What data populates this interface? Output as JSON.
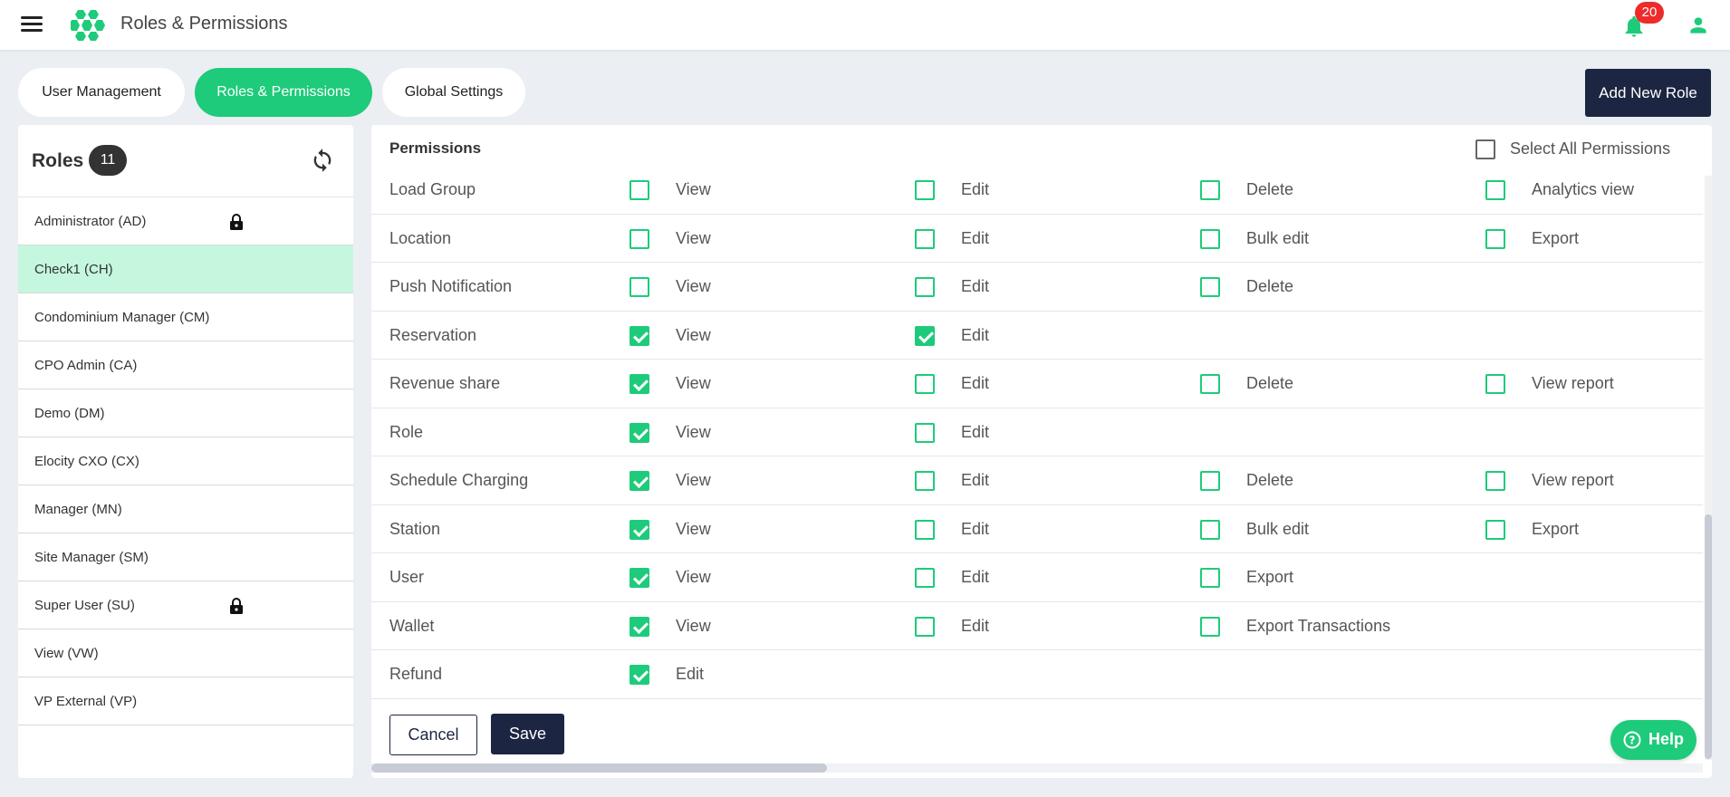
{
  "header": {
    "app_title": "Roles & Permissions",
    "notification_count": "20",
    "icons": [
      "menu-icon",
      "hexagon-logo",
      "bell-icon",
      "user-icon"
    ]
  },
  "tabs": [
    {
      "label": "User Management",
      "active": false
    },
    {
      "label": "Roles & Permissions",
      "active": true
    },
    {
      "label": "Global Settings",
      "active": false
    }
  ],
  "add_role_label": "Add New Role",
  "roles_panel": {
    "title": "Roles",
    "count": "11",
    "items": [
      {
        "label": "Administrator (AD)",
        "locked": true,
        "selected": false
      },
      {
        "label": "Check1 (CH)",
        "locked": false,
        "selected": true
      },
      {
        "label": "Condominium Manager (CM)",
        "locked": false,
        "selected": false
      },
      {
        "label": "CPO Admin (CA)",
        "locked": false,
        "selected": false
      },
      {
        "label": "Demo (DM)",
        "locked": false,
        "selected": false
      },
      {
        "label": "Elocity CXO (CX)",
        "locked": false,
        "selected": false
      },
      {
        "label": "Manager (MN)",
        "locked": false,
        "selected": false
      },
      {
        "label": "Site Manager (SM)",
        "locked": false,
        "selected": false
      },
      {
        "label": "Super User (SU)",
        "locked": true,
        "selected": false
      },
      {
        "label": "View (VW)",
        "locked": false,
        "selected": false
      },
      {
        "label": "VP External (VP)",
        "locked": false,
        "selected": false
      }
    ]
  },
  "permissions": {
    "title": "Permissions",
    "select_all_label": "Select All Permissions",
    "select_all_checked": false,
    "rows": [
      {
        "name": "Load Group",
        "perms": [
          {
            "label": "View",
            "checked": false
          },
          {
            "label": "Edit",
            "checked": false
          },
          {
            "label": "Delete",
            "checked": false
          },
          {
            "label": "Analytics view",
            "checked": false
          }
        ]
      },
      {
        "name": "Location",
        "perms": [
          {
            "label": "View",
            "checked": false
          },
          {
            "label": "Edit",
            "checked": false
          },
          {
            "label": "Bulk edit",
            "checked": false
          },
          {
            "label": "Export",
            "checked": false
          }
        ]
      },
      {
        "name": "Push Notification",
        "perms": [
          {
            "label": "View",
            "checked": false
          },
          {
            "label": "Edit",
            "checked": false
          },
          {
            "label": "Delete",
            "checked": false
          }
        ]
      },
      {
        "name": "Reservation",
        "perms": [
          {
            "label": "View",
            "checked": true
          },
          {
            "label": "Edit",
            "checked": true
          }
        ]
      },
      {
        "name": "Revenue share",
        "perms": [
          {
            "label": "View",
            "checked": true
          },
          {
            "label": "Edit",
            "checked": false
          },
          {
            "label": "Delete",
            "checked": false
          },
          {
            "label": "View report",
            "checked": false
          }
        ]
      },
      {
        "name": "Role",
        "perms": [
          {
            "label": "View",
            "checked": true
          },
          {
            "label": "Edit",
            "checked": false
          }
        ]
      },
      {
        "name": "Schedule Charging",
        "perms": [
          {
            "label": "View",
            "checked": true
          },
          {
            "label": "Edit",
            "checked": false
          },
          {
            "label": "Delete",
            "checked": false
          },
          {
            "label": "View report",
            "checked": false
          }
        ]
      },
      {
        "name": "Station",
        "perms": [
          {
            "label": "View",
            "checked": true
          },
          {
            "label": "Edit",
            "checked": false
          },
          {
            "label": "Bulk edit",
            "checked": false
          },
          {
            "label": "Export",
            "checked": false
          }
        ]
      },
      {
        "name": "User",
        "perms": [
          {
            "label": "View",
            "checked": true
          },
          {
            "label": "Edit",
            "checked": false
          },
          {
            "label": "Export",
            "checked": false
          }
        ]
      },
      {
        "name": "Wallet",
        "perms": [
          {
            "label": "View",
            "checked": true
          },
          {
            "label": "Edit",
            "checked": false
          },
          {
            "label": "Export Transactions",
            "checked": false
          }
        ]
      },
      {
        "name": "Refund",
        "perms": [
          {
            "label": "Edit",
            "checked": true
          }
        ]
      }
    ]
  },
  "buttons": {
    "cancel": "Cancel",
    "save": "Save"
  },
  "help_label": "Help",
  "colors": {
    "accent": "#1ecb7a",
    "navy": "#1c2541",
    "badge": "#ef2a2a",
    "selected_row": "#c4f7de"
  }
}
